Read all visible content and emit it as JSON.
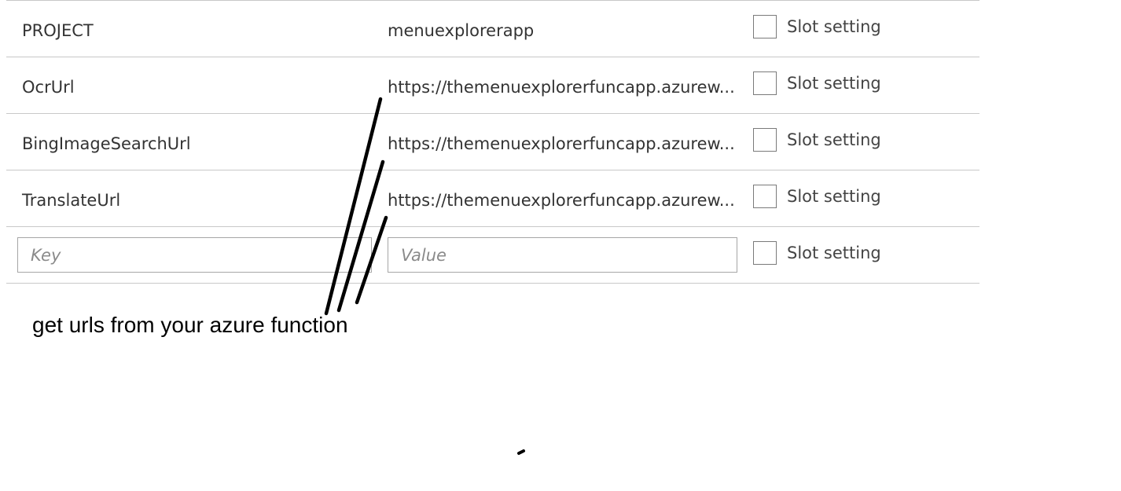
{
  "app_settings": {
    "rows": [
      {
        "key": "PROJECT",
        "value": "menuexplorerapp",
        "slot_label": "Slot setting"
      },
      {
        "key": "OcrUrl",
        "value": "https://themenuexplorerfuncapp.azurew...",
        "slot_label": "Slot setting"
      },
      {
        "key": "BingImageSearchUrl",
        "value": "https://themenuexplorerfuncapp.azurew...",
        "slot_label": "Slot setting"
      },
      {
        "key": "TranslateUrl",
        "value": "https://themenuexplorerfuncapp.azurew...",
        "slot_label": "Slot setting"
      }
    ],
    "new_row": {
      "key_placeholder": "Key",
      "value_placeholder": "Value",
      "slot_label": "Slot setting"
    }
  },
  "annotation": {
    "text": "get urls from your azure function"
  }
}
